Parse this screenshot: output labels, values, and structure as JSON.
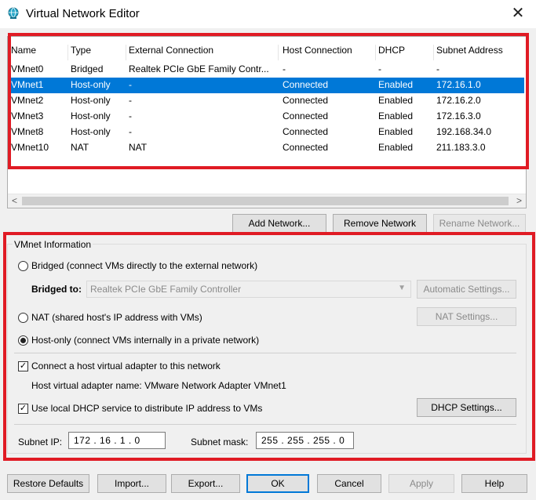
{
  "window": {
    "title": "Virtual Network Editor",
    "close_glyph": "✕"
  },
  "table": {
    "columns": [
      "Name",
      "Type",
      "External Connection",
      "Host Connection",
      "DHCP",
      "Subnet Address"
    ],
    "rows": [
      [
        "VMnet0",
        "Bridged",
        "Realtek PCIe GbE Family Contr...",
        "-",
        "-",
        "-"
      ],
      [
        "VMnet1",
        "Host-only",
        "-",
        "Connected",
        "Enabled",
        "172.16.1.0"
      ],
      [
        "VMnet2",
        "Host-only",
        "-",
        "Connected",
        "Enabled",
        "172.16.2.0"
      ],
      [
        "VMnet3",
        "Host-only",
        "-",
        "Connected",
        "Enabled",
        "172.16.3.0"
      ],
      [
        "VMnet8",
        "Host-only",
        "-",
        "Connected",
        "Enabled",
        "192.168.34.0"
      ],
      [
        "VMnet10",
        "NAT",
        "NAT",
        "Connected",
        "Enabled",
        "211.183.3.0"
      ]
    ],
    "selected_row": "VMnet1"
  },
  "scroll": {
    "left": "<",
    "right": ">"
  },
  "network_buttons": {
    "add": "Add Network...",
    "remove": "Remove Network",
    "rename": "Rename Network..."
  },
  "vmnet_info": {
    "title": "VMnet Information",
    "bridged_label": "Bridged (connect VMs directly to the external network)",
    "bridged_to_label": "Bridged to:",
    "bridged_to_value": "Realtek PCIe GbE Family Controller",
    "automatic_settings": "Automatic Settings...",
    "nat_label": "NAT (shared host's IP address with VMs)",
    "nat_settings": "NAT Settings...",
    "hostonly_label": "Host-only (connect VMs internally in a private network)",
    "selected_mode": "host-only",
    "connect_adapter_label": "Connect a host virtual adapter to this network",
    "connect_adapter_checked": true,
    "adapter_name_text": "Host virtual adapter name: VMware Network Adapter VMnet1",
    "dhcp_label": "Use local DHCP service to distribute IP address to VMs",
    "dhcp_checked": true,
    "dhcp_settings": "DHCP Settings...",
    "subnet_ip_label": "Subnet IP:",
    "subnet_ip_value": "172 . 16 . 1 . 0",
    "subnet_mask_label": "Subnet mask:",
    "subnet_mask_value": "255 . 255 . 255 . 0"
  },
  "bottom_buttons": {
    "restore": "Restore Defaults",
    "import": "Import...",
    "export": "Export...",
    "ok": "OK",
    "cancel": "Cancel",
    "apply": "Apply",
    "help": "Help"
  },
  "colors": {
    "highlight": "#0078d7",
    "annotation": "#e01b24"
  }
}
